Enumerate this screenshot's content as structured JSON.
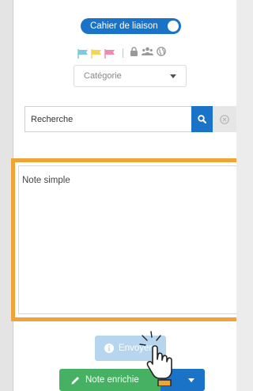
{
  "toggle": {
    "label": "Cahier de liaison",
    "checked": true
  },
  "filters": {
    "flags": [
      {
        "icon": "flag-icon",
        "color": "#7ec9e0"
      },
      {
        "icon": "flag-icon",
        "color": "#f3d55b"
      },
      {
        "icon": "flag-icon",
        "color": "#f08ab0"
      }
    ],
    "icons": [
      "lock-icon",
      "users-icon",
      "globe-icon"
    ]
  },
  "category": {
    "value": "Catégorie"
  },
  "search": {
    "placeholder": "Recherche"
  },
  "note": {
    "placeholder": "Note simple"
  },
  "send": {
    "label": "Envoyer"
  },
  "rich_note": {
    "label": "Note enrichie"
  },
  "colors": {
    "accent": "#1a73c6",
    "highlight": "#f0a437",
    "success": "#46b162",
    "disabled": "#b6d6ef"
  }
}
